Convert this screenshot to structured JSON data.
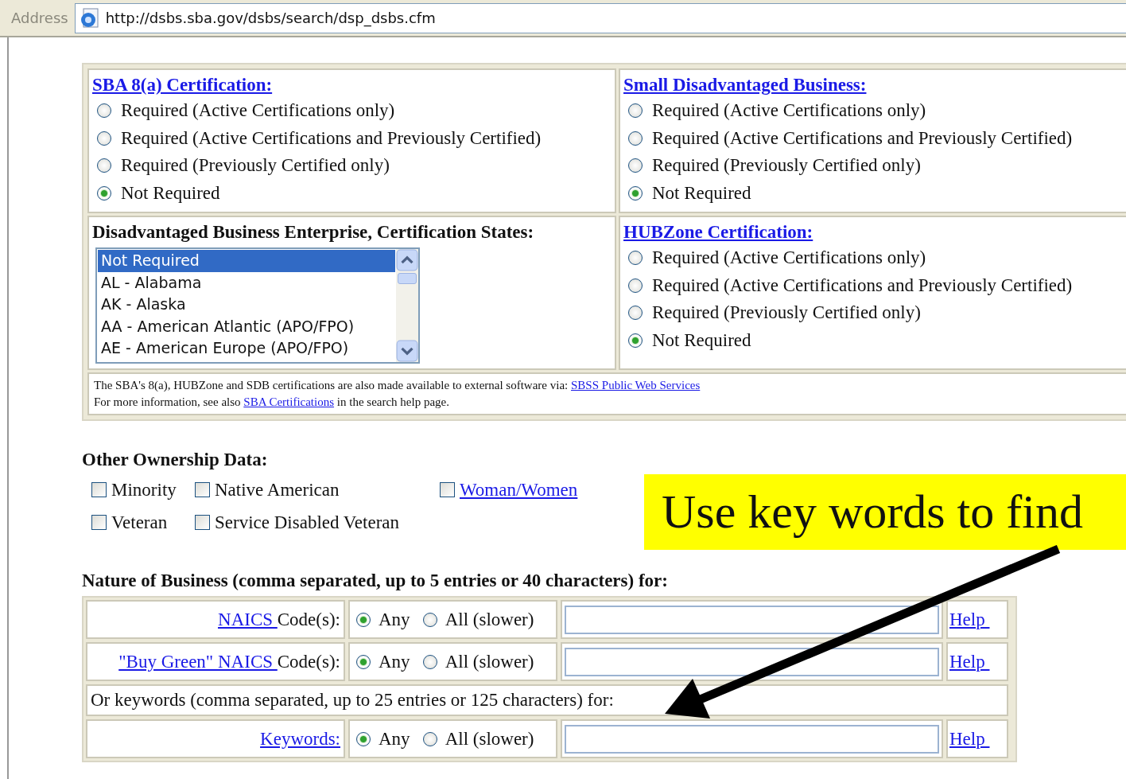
{
  "address_bar": {
    "label": "Address",
    "url": "http://dsbs.sba.gov/dsbs/search/dsp_dsbs.cfm"
  },
  "certification_panels": [
    {
      "kind": "radio",
      "title": "SBA 8(a) Certification:",
      "title_link": true,
      "options": [
        {
          "label": "Required (Active Certifications only)",
          "selected": false
        },
        {
          "label": "Required (Active Certifications and Previously Certified)",
          "selected": false
        },
        {
          "label": "Required (Previously Certified only)",
          "selected": false
        },
        {
          "label": "Not Required",
          "selected": true
        }
      ]
    },
    {
      "kind": "radio",
      "title": "Small Disadvantaged Business:",
      "title_link": true,
      "options": [
        {
          "label": "Required (Active Certifications only)",
          "selected": false
        },
        {
          "label": "Required (Active Certifications and Previously Certified)",
          "selected": false
        },
        {
          "label": "Required (Previously Certified only)",
          "selected": false
        },
        {
          "label": "Not Required",
          "selected": true
        }
      ]
    },
    {
      "kind": "listbox",
      "title": "Disadvantaged Business Enterprise, Certification States:",
      "title_link": false,
      "options": [
        {
          "label": "Not Required",
          "selected": true
        },
        {
          "label": "AL - Alabama",
          "selected": false
        },
        {
          "label": "AK - Alaska",
          "selected": false
        },
        {
          "label": "AA - American Atlantic (APO/FPO)",
          "selected": false
        },
        {
          "label": "AE - American Europe (APO/FPO)",
          "selected": false
        }
      ]
    },
    {
      "kind": "radio",
      "title": "HUBZone Certification:",
      "title_link": true,
      "options": [
        {
          "label": "Required (Active Certifications only)",
          "selected": false
        },
        {
          "label": "Required (Active Certifications and Previously Certified)",
          "selected": false
        },
        {
          "label": "Required (Previously Certified only)",
          "selected": false
        },
        {
          "label": "Not Required",
          "selected": true
        }
      ]
    }
  ],
  "certification_note": [
    [
      {
        "kind": "text",
        "text": "The SBA's 8(a), HUBZone and SDB certifications are also made available to external software via: "
      },
      {
        "kind": "link",
        "text": "SBSS Public Web Services"
      }
    ],
    [
      {
        "kind": "text",
        "text": "For more information, see also "
      },
      {
        "kind": "link",
        "text": "SBA Certifications"
      },
      {
        "kind": "text",
        "text": " in the search help page."
      }
    ]
  ],
  "ownership": {
    "title": "Other Ownership Data:",
    "rows": [
      [
        {
          "label": "Minority",
          "link": false,
          "checked": false
        },
        {
          "label": "Native American",
          "link": false,
          "checked": false
        },
        {
          "label": "Woman/Women",
          "link": true,
          "checked": false
        }
      ],
      [
        {
          "label": "Veteran",
          "link": false,
          "checked": false
        },
        {
          "label": "Service Disabled Veteran",
          "link": false,
          "checked": false
        }
      ]
    ]
  },
  "nature": {
    "title": "Nature of Business (comma separated, up to 5 entries or 40 characters) for:",
    "rows": [
      {
        "kind": "field",
        "link": "NAICS ",
        "suffix": "Code(s):",
        "options": [
          {
            "label": "Any",
            "selected": true
          },
          {
            "label": "All (slower)",
            "selected": false
          }
        ],
        "help": "Help "
      },
      {
        "kind": "field",
        "link": "\"Buy Green\" NAICS ",
        "suffix": "Code(s):",
        "options": [
          {
            "label": "Any",
            "selected": true
          },
          {
            "label": "All (slower)",
            "selected": false
          }
        ],
        "help": "Help "
      },
      {
        "kind": "note",
        "text": "Or keywords (comma separated, up to 25 entries or 125 characters) for:"
      },
      {
        "kind": "field",
        "link": "Keywords:",
        "suffix": "",
        "options": [
          {
            "label": "Any",
            "selected": true
          },
          {
            "label": "All (slower)",
            "selected": false
          }
        ],
        "help": "Help "
      }
    ]
  },
  "callout": {
    "text": "Use key words to find"
  }
}
